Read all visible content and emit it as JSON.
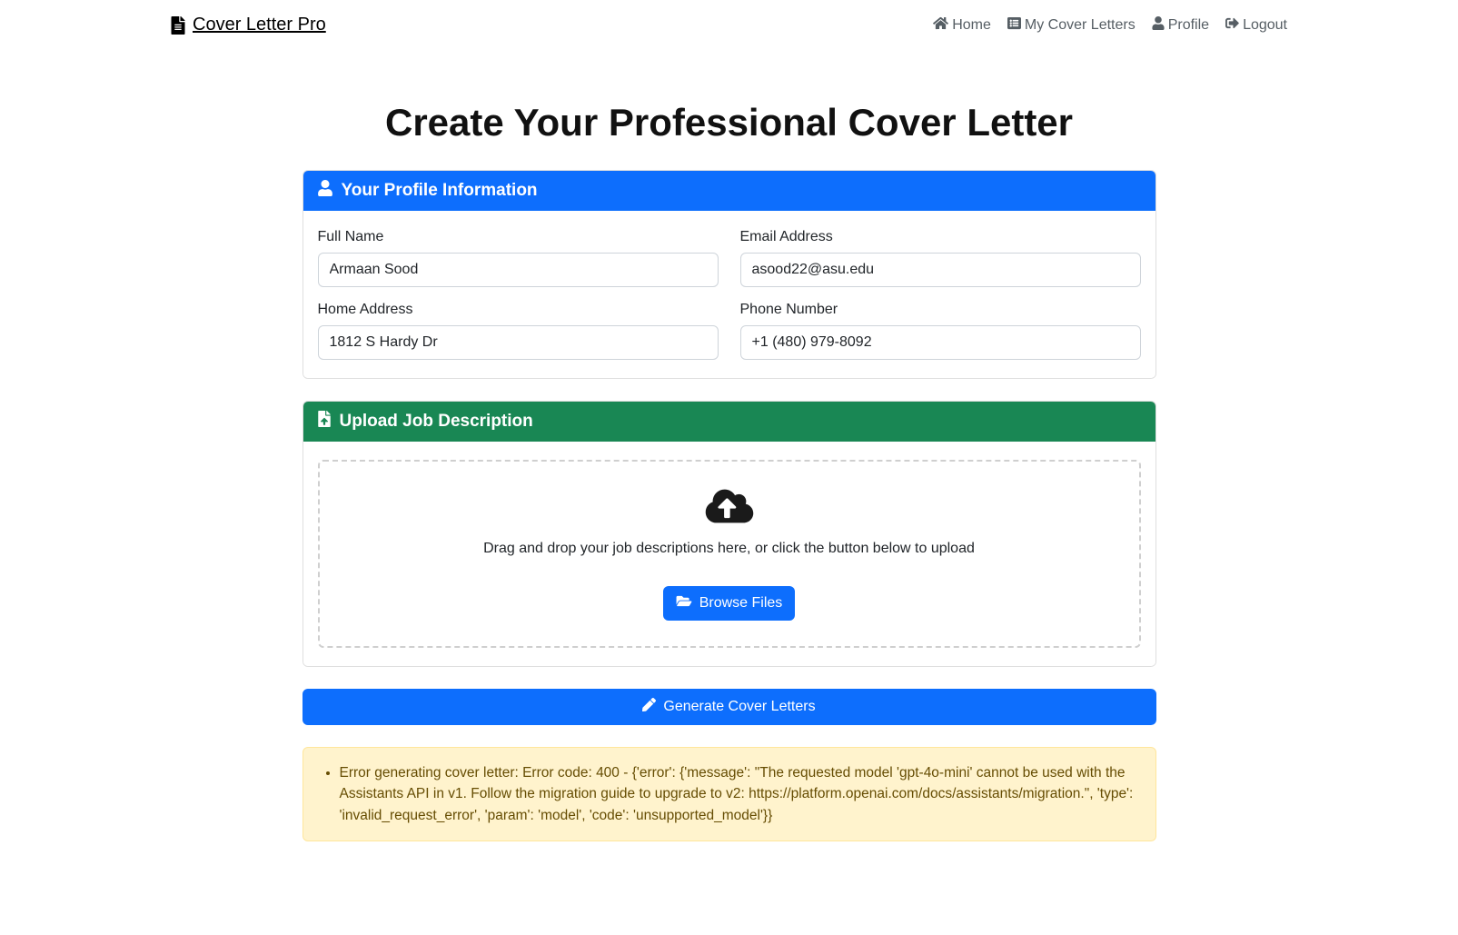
{
  "brand": {
    "name": "Cover Letter Pro"
  },
  "nav": {
    "home": "Home",
    "myCoverLetters": "My Cover Letters",
    "profile": "Profile",
    "logout": "Logout"
  },
  "pageTitle": "Create Your Professional Cover Letter",
  "profileSection": {
    "title": "Your Profile Information",
    "fullNameLabel": "Full Name",
    "fullNameValue": "Armaan Sood",
    "emailLabel": "Email Address",
    "emailValue": "asood22@asu.edu",
    "addressLabel": "Home Address",
    "addressValue": "1812 S Hardy Dr",
    "phoneLabel": "Phone Number",
    "phoneValue": "+1 (480) 979-8092"
  },
  "uploadSection": {
    "title": "Upload Job Description",
    "instruction": "Drag and drop your job descriptions here, or click the button below to upload",
    "browseLabel": "Browse Files"
  },
  "generateButton": {
    "label": "Generate Cover Letters"
  },
  "alert": {
    "message": "Error generating cover letter: Error code: 400 - {'error': {'message': \"The requested model 'gpt-4o-mini' cannot be used with the Assistants API in v1. Follow the migration guide to upgrade to v2: https://platform.openai.com/docs/assistants/migration.\", 'type': 'invalid_request_error', 'param': 'model', 'code': 'unsupported_model'}}"
  }
}
